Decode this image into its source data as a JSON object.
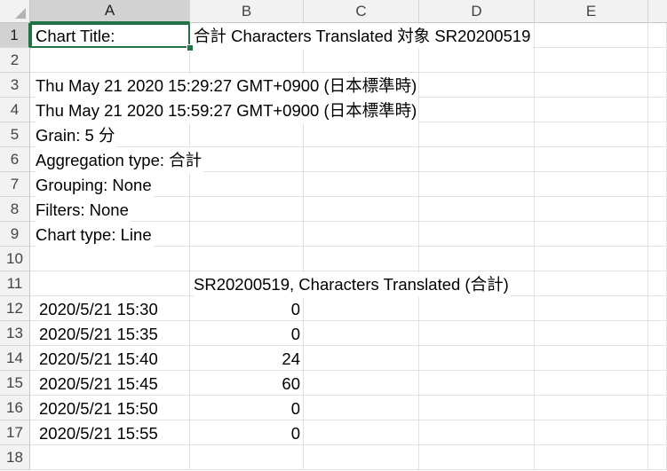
{
  "columns": [
    "A",
    "B",
    "C",
    "D",
    "E"
  ],
  "rows": [
    "1",
    "2",
    "3",
    "4",
    "5",
    "6",
    "7",
    "8",
    "9",
    "10",
    "11",
    "12",
    "13",
    "14",
    "15",
    "16",
    "17",
    "18"
  ],
  "cells": {
    "a1": "Chart Title:",
    "b1": "合計 Characters Translated 対象 SR20200519",
    "a3": "Thu May 21 2020 15:29:27 GMT+0900 (日本標準時)",
    "a4": "Thu May 21 2020 15:59:27 GMT+0900 (日本標準時)",
    "a5": "Grain: 5 分",
    "a6": "Aggregation type: 合計",
    "a7": "Grouping: None",
    "a8": "Filters: None",
    "a9": "Chart type: Line",
    "b11": "SR20200519, Characters Translated (合計)",
    "table": [
      {
        "time": "2020/5/21 15:30",
        "value": "0"
      },
      {
        "time": "2020/5/21 15:35",
        "value": "0"
      },
      {
        "time": "2020/5/21 15:40",
        "value": "24"
      },
      {
        "time": "2020/5/21 15:45",
        "value": "60"
      },
      {
        "time": "2020/5/21 15:50",
        "value": "0"
      },
      {
        "time": "2020/5/21 15:55",
        "value": "0"
      }
    ]
  },
  "selection": {
    "active_cell": "A1",
    "accent_color": "#217346"
  }
}
